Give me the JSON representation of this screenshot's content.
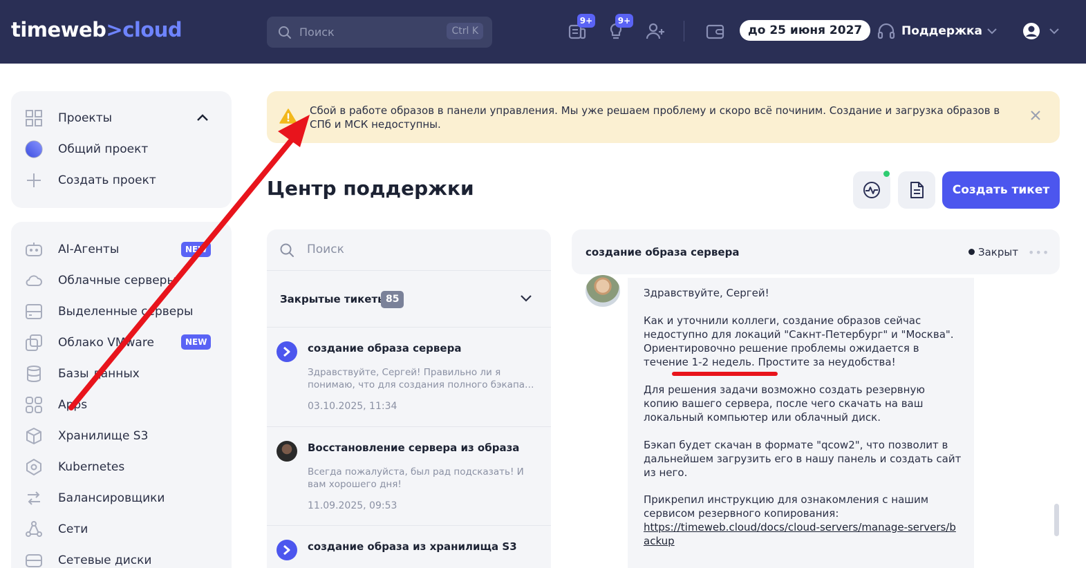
{
  "header": {
    "logo_main": "timeweb",
    "logo_sep": ">",
    "logo_accent": "cloud",
    "search_placeholder": "Поиск",
    "search_shortcut": "Ctrl K",
    "badge_1": "9+",
    "badge_2": "9+",
    "balance_date": "до 25 июня 2027",
    "support_label": "Поддержка"
  },
  "sidebar": {
    "projects": {
      "title": "Проекты",
      "items": [
        "Общий проект",
        "Создать проект"
      ]
    },
    "items": [
      {
        "label": "AI-Агенты",
        "badge": "NEW"
      },
      {
        "label": "Облачные серверы"
      },
      {
        "label": "Выделенные серверы"
      },
      {
        "label": "Облако VMware",
        "badge": "NEW"
      },
      {
        "label": "Базы данных"
      },
      {
        "label": "Apps"
      },
      {
        "label": "Хранилище S3"
      },
      {
        "label": "Kubernetes"
      },
      {
        "label": "Балансировщики"
      },
      {
        "label": "Сети"
      },
      {
        "label": "Сетевые диски"
      }
    ]
  },
  "alert": {
    "text": "Сбой в работе образов в панели управления. Мы уже решаем проблему и скоро всё починим. Создание и загрузка образов в СПб и МСК недоступны."
  },
  "page": {
    "title": "Центр поддержки",
    "create_ticket": "Создать тикет"
  },
  "tickets": {
    "search_placeholder": "Поиск",
    "filter_label": "Закрытые тикеты",
    "filter_count": "85",
    "items": [
      {
        "title": "создание образа сервера",
        "snippet": "Здравствуйте, Сергей! Правильно ли я понимаю, что для создания полного бэкапа…",
        "date": "03.10.2025, 11:34"
      },
      {
        "title": "Восстановление сервера из образа",
        "snippet": "Всегда пожалуйста, был рад подсказать! И вам хорошего дня!",
        "date": "11.09.2025, 09:53"
      },
      {
        "title": "создание образа из хранилища S3",
        "snippet": "",
        "date": ""
      }
    ]
  },
  "conversation": {
    "title": "создание образа сервера",
    "status": "Закрыт",
    "message": {
      "greeting": "Здравствуйте, Сергей!",
      "p1": "Как и уточнили коллеги, создание образов сейчас недоступно для локаций \"Сакнт-Петербург\" и \"Москва\". Ориентировочно решение проблемы ожидается в течение 1-2 недель. Простите за неудобства!",
      "p2": "Для решения задачи возможно создать резервную копию вашего сервера, после чего скачать на ваш локальный компьютер или облачный диск.",
      "p3": "Бэкап будет скачан в формате \"qcow2\", что позволит в дальнейшем загрузить его в нашу панель и создать сайт из него.",
      "p4": "Прикрепил инструкцию для ознакомления с нашим сервисом резервного копирования:",
      "link": "https://timeweb.cloud/docs/cloud-servers/manage-servers/backup"
    }
  },
  "colors": {
    "header_bg": "#2a2f55",
    "accent": "#4c56ee",
    "alert_bg": "#fbf0d2",
    "annotation": "#e8141c"
  }
}
